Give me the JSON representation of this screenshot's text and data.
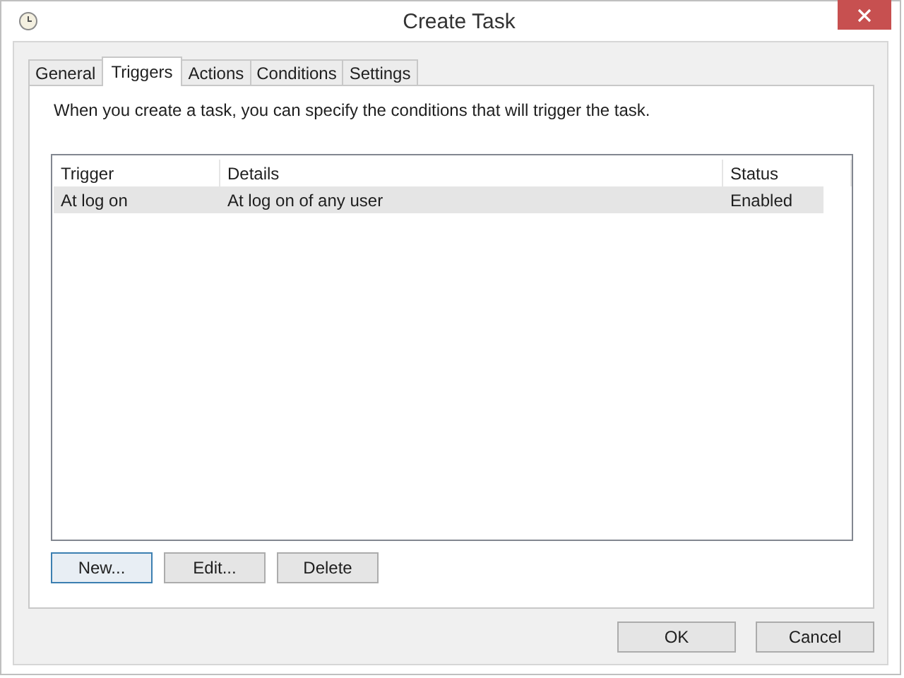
{
  "window": {
    "title": "Create Task"
  },
  "tabs": [
    {
      "label": "General",
      "selected": false
    },
    {
      "label": "Triggers",
      "selected": true
    },
    {
      "label": "Actions",
      "selected": false
    },
    {
      "label": "Conditions",
      "selected": false
    },
    {
      "label": "Settings",
      "selected": false
    }
  ],
  "description": "When you create a task, you can specify the conditions that will trigger the task.",
  "table": {
    "columns": [
      "Trigger",
      "Details",
      "Status"
    ],
    "rows": [
      {
        "cells": [
          "At log on",
          "At log on of any user",
          "Enabled"
        ],
        "selected": true
      }
    ]
  },
  "list_buttons": [
    {
      "label": "New...",
      "focused": true
    },
    {
      "label": "Edit...",
      "focused": false
    },
    {
      "label": "Delete",
      "focused": false
    }
  ],
  "buttons": [
    {
      "label": "OK",
      "focused": false
    },
    {
      "label": "Cancel",
      "focused": false
    }
  ]
}
